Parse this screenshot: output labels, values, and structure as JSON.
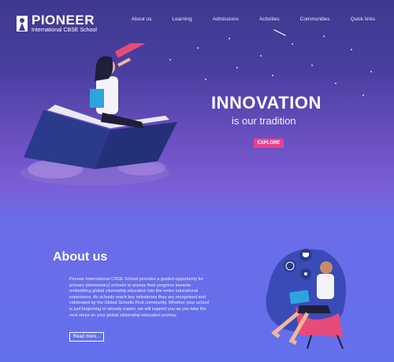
{
  "brand": {
    "name": "PIONEER",
    "tagline": "International CBSE School"
  },
  "nav": [
    "About us",
    "Learning",
    "Admissions",
    "Activities",
    "Communities",
    "Quick links"
  ],
  "hero": {
    "title": "INNOVATION",
    "subtitle": "is our tradition",
    "cta": "EXPLORE"
  },
  "about": {
    "title": "About us",
    "lines": [
      "Pioneer International CBSE School provides a guided opportunity for",
      "primary (elementary) schools to assess their progress towards",
      "embedding global citizenship education into the entire educational",
      "experience. As schools reach key milestones they are recognized and",
      "celebrated by the Global Schools First community. Whether your school",
      "is just beginning or already expert, we will support you as you take the",
      "next steps on your global citizenship education journey."
    ],
    "read_more": "Read more..."
  },
  "colors": {
    "accent": "#e8428f",
    "bg_top": "#3d3a8f",
    "bg_bottom": "#6470ec"
  },
  "icons": [
    "logo-mark-icon",
    "telescope-icon",
    "book-icon",
    "laptop-icon",
    "globe-icon",
    "trophy-icon",
    "atom-icon"
  ]
}
